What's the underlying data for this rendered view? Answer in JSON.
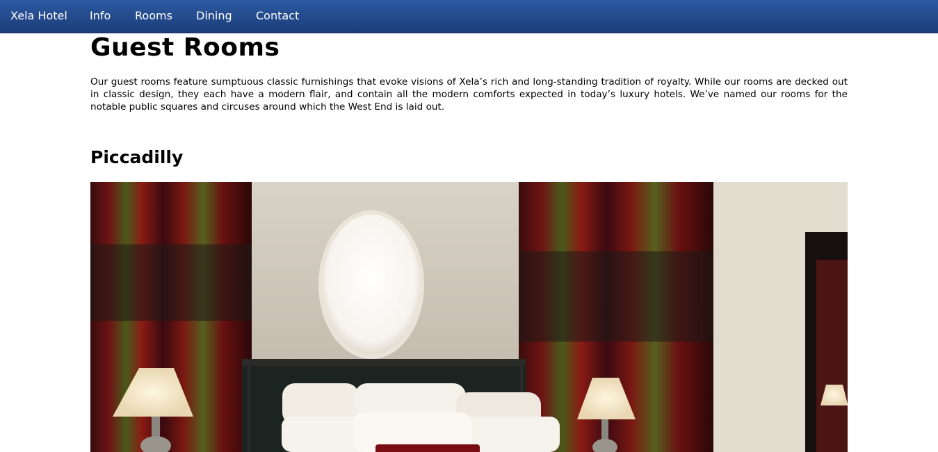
{
  "nav": {
    "brand": "Xela Hotel",
    "links": [
      "Info",
      "Rooms",
      "Dining",
      "Contact"
    ],
    "background_color": "#2c5aa2"
  },
  "page": {
    "title": "Guest Rooms",
    "intro": "Our guest rooms feature sumptuous classic furnishings that evoke visions of Xela’s rich and long-standing tradition of royalty. While our rooms are decked out in classic design, they each have a modern flair, and contain all the modern comforts expected in today’s luxury hotels. We’ve named our rooms for the notable public squares and circuses around which the West End is laid out."
  },
  "rooms": [
    {
      "name": "Piccadilly",
      "image": "hotel-room-photo"
    }
  ]
}
